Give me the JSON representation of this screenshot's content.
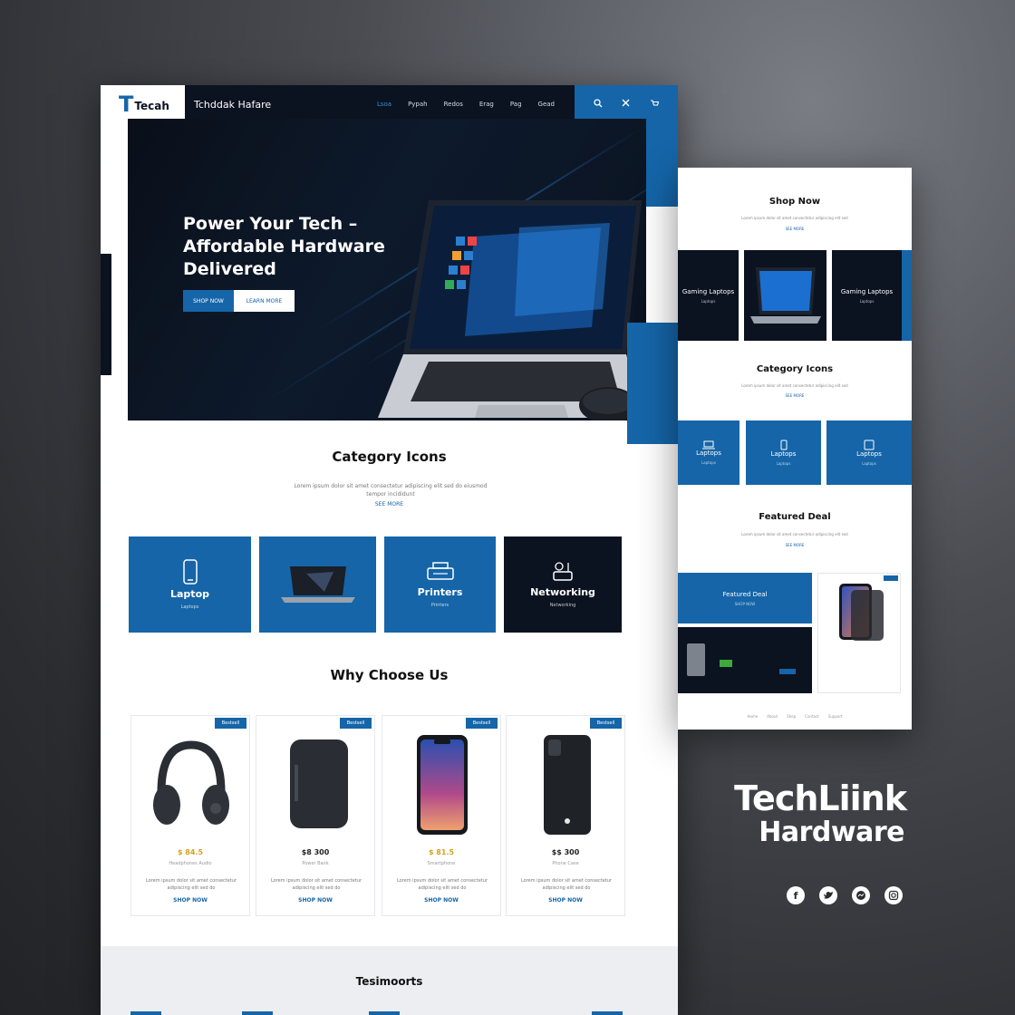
{
  "colors": {
    "accent": "#1565a8",
    "dark": "#0b1220",
    "price": "#d4a21a"
  },
  "nav": {
    "logo_mark": "T",
    "logo_text": "Tecah",
    "brand": "Tchddak Hafare",
    "links": [
      "Lsoa",
      "Pypah",
      "Redos",
      "Erag",
      "Pag",
      "Gead"
    ],
    "icons": [
      "search-icon",
      "close-icon",
      "cart-icon"
    ]
  },
  "hero": {
    "title": "Power Your Tech – Affordable Hardware Delivered",
    "primary_btn": "SHOP NOW",
    "secondary_btn": "LEARN MORE"
  },
  "categories": {
    "title": "Category Icons",
    "subtitle": "Lorem ipsum dolor sit amet consectetur adipiscing elit sed do eiusmod tempor incididunt",
    "link": "SEE MORE",
    "items": [
      {
        "name": "Laptop",
        "sub": "Laptops",
        "icon": "phone-icon"
      },
      {
        "name": "",
        "sub": "",
        "icon": "laptop-icon"
      },
      {
        "name": "Printers",
        "sub": "Printers",
        "icon": "printer-icon"
      },
      {
        "name": "Networking",
        "sub": "Networking",
        "icon": "router-icon"
      }
    ]
  },
  "why": {
    "title": "Why Choose Us",
    "products": [
      {
        "badge": "Bestsell",
        "price": "$ 84.5",
        "meta": "Headphones Audio",
        "desc": "Lorem ipsum dolor sit amet consectetur adipiscing elit sed do",
        "link": "SHOP NOW",
        "icon": "headphones-icon"
      },
      {
        "badge": "Bestsell",
        "price": "$8 300",
        "meta": "Power Bank",
        "desc": "Lorem ipsum dolor sit amet consectetur adipiscing elit sed do",
        "link": "SHOP NOW",
        "icon": "powerbank-icon"
      },
      {
        "badge": "Bestsell",
        "price": "$ 81.5",
        "meta": "Smartphone",
        "desc": "Lorem ipsum dolor sit amet consectetur adipiscing elit sed do",
        "link": "SHOP NOW",
        "icon": "smartphone-icon"
      },
      {
        "badge": "Bestsell",
        "price": "$$ 300",
        "meta": "Phone Case",
        "desc": "Lorem ipsum dolor sit amet consectetur adipiscing elit sed do",
        "link": "SHOP NOW",
        "icon": "phone-case-icon"
      }
    ]
  },
  "testimonials": {
    "title": "Tesimoorts"
  },
  "side_page": {
    "shop_title": "Shop Now",
    "shop_sub": "Lorem ipsum dolor sit amet consectetur adipiscing elit sed",
    "shop_link": "SEE MORE",
    "shop_tiles": [
      {
        "name": "Gaming Laptops",
        "sub": "Laptops"
      },
      {
        "name": "",
        "sub": ""
      },
      {
        "name": "Gaming Laptops",
        "sub": "Laptops"
      }
    ],
    "category_title": "Category Icons",
    "category_sub": "Lorem ipsum dolor sit amet consectetur adipiscing elit sed",
    "category_link": "SEE MORE",
    "category_tiles": [
      {
        "name": "Laptops",
        "sub": "Laptops",
        "icon": "laptop-icon"
      },
      {
        "name": "Laptops",
        "sub": "Laptops",
        "icon": "phone-icon"
      },
      {
        "name": "Laptops",
        "sub": "Laptops",
        "icon": "tablet-icon"
      }
    ],
    "featured_title": "Featured Deal",
    "featured_sub": "Lorem ipsum dolor sit amet consectetur adipiscing elit sed",
    "featured_link": "SEE MORE",
    "featured_box_title": "Featured Deal",
    "featured_box_sub": "SHOP NOW",
    "footer_links": [
      "Home",
      "About",
      "Shop",
      "Contact",
      "Support"
    ]
  },
  "brand": {
    "line1": "TechLiink",
    "line2": "Hardware"
  },
  "socials": [
    "facebook-icon",
    "twitter-icon",
    "messenger-icon",
    "instagram-icon"
  ]
}
